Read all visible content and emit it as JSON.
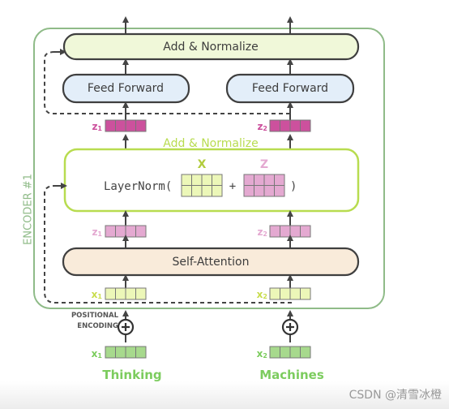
{
  "encoder_label": "ENCODER #1",
  "add_normalize_top": "Add & Normalize",
  "feed_forward": [
    "Feed Forward",
    "Feed Forward"
  ],
  "add_normalize_mid": "Add & Normalize",
  "layernorm": {
    "func": "LayerNorm(",
    "plus": "+",
    "close": ")",
    "x_label": "X",
    "z_label": "Z"
  },
  "self_attention": "Self-Attention",
  "vectors": {
    "z_top": [
      {
        "sym": "z",
        "sub": "1"
      },
      {
        "sym": "z",
        "sub": "2"
      }
    ],
    "z_mid": [
      {
        "sym": "z",
        "sub": "1"
      },
      {
        "sym": "z",
        "sub": "2"
      }
    ],
    "x_in": [
      {
        "sym": "x",
        "sub": "1"
      },
      {
        "sym": "x",
        "sub": "2"
      }
    ],
    "x_embed": [
      {
        "sym": "x",
        "sub": "1"
      },
      {
        "sym": "x",
        "sub": "2"
      }
    ]
  },
  "positional_encoding": [
    "POSITIONAL",
    "ENCODING"
  ],
  "words": [
    "Thinking",
    "Machines"
  ],
  "watermark": "CSDN @清雪冰橙",
  "colors": {
    "encoder_border": "#8fbb88",
    "add_norm_fill": "#f0f8d9",
    "feed_forward_fill": "#e3eef9",
    "self_attention_fill": "#f9ebda",
    "layernorm_border": "#b8dc50",
    "z_dark": "#cc519d",
    "z_light": "#e4a9d1",
    "x_light": "#ecf7b8",
    "x_embed": "#a7d98d"
  }
}
